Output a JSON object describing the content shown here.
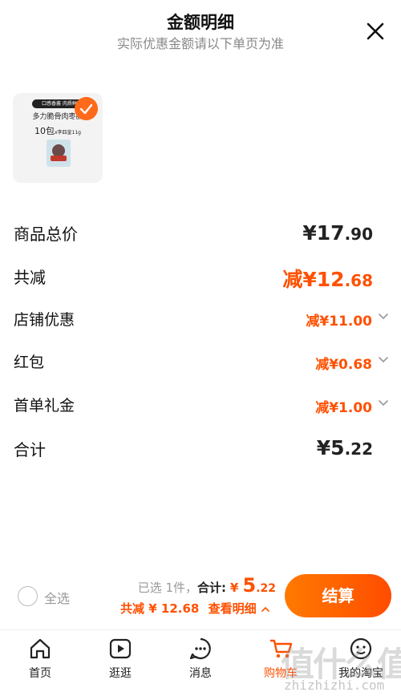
{
  "header": {
    "title": "金额明细",
    "subtitle": "实际优惠金额请以下单页为准",
    "close_icon": "close-icon"
  },
  "product": {
    "tag": "口感香酱 肉质鲜嫩",
    "name": "多力脆骨肉枣肠",
    "qty_main": "10包",
    "qty_note": "x李四皇11g",
    "selected": true,
    "badge_color": "#ff6a1a"
  },
  "summary": {
    "total_label": "商品总价",
    "total_symbol": "¥",
    "total_int": "17",
    "total_dec": ".90",
    "reduce_label": "共减",
    "reduce_prefix": "减",
    "reduce_symbol": "¥",
    "reduce_int": "12",
    "reduce_dec": ".68",
    "rows": [
      {
        "label": "店铺优惠",
        "amount": "减¥11.00"
      },
      {
        "label": "红包",
        "amount": "减¥0.68"
      },
      {
        "label": "首单礼金",
        "amount": "减¥1.00"
      }
    ],
    "sum_label": "合计",
    "sum_symbol": "¥",
    "sum_int": "5",
    "sum_dec": ".22"
  },
  "checkout": {
    "select_all": "全选",
    "selected_text": "已选 1件，",
    "sum_label": "合计:",
    "price_symbol": "¥",
    "price_int": "5",
    "price_dec": ".22",
    "discount_text": "共减 ¥ 12.68",
    "details_link": "查看明细",
    "button": "结算",
    "accent_color": "#ff5000"
  },
  "tabs": [
    {
      "label": "首页",
      "icon": "home-icon"
    },
    {
      "label": "逛逛",
      "icon": "video-icon"
    },
    {
      "label": "消息",
      "icon": "message-icon"
    },
    {
      "label": "购物车",
      "icon": "cart-icon",
      "active": true
    },
    {
      "label": "我的淘宝",
      "icon": "profile-icon"
    }
  ],
  "watermark": {
    "glyphs": "值什么值",
    "url": "zhizhizhi.com"
  }
}
